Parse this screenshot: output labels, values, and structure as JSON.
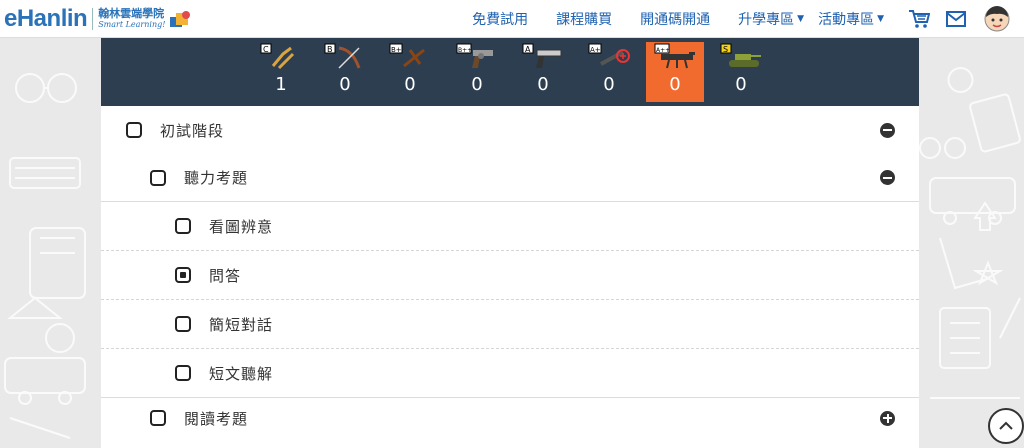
{
  "header": {
    "logo_text": "eHanlin",
    "logo_cn": "翰林雲端學院",
    "logo_en": "Smart Learning!",
    "nav": [
      {
        "label": "免費試用"
      },
      {
        "label": "課程購買"
      },
      {
        "label": "開通碼開通"
      },
      {
        "label": "升學專區",
        "caret": "▼"
      },
      {
        "label": "活動專區",
        "caret": "▼"
      }
    ],
    "icons": [
      "cart-icon",
      "mail-icon",
      "avatar"
    ]
  },
  "weapons": [
    {
      "grade": "C",
      "count": "1",
      "icon": "slingshot-icon"
    },
    {
      "grade": "B",
      "count": "0",
      "icon": "bow-icon"
    },
    {
      "grade": "B+",
      "count": "0",
      "icon": "crossbow-icon"
    },
    {
      "grade": "B++",
      "count": "0",
      "icon": "revolver-icon"
    },
    {
      "grade": "A",
      "count": "0",
      "icon": "pistol-icon"
    },
    {
      "grade": "A+",
      "count": "0",
      "icon": "rifle-icon"
    },
    {
      "grade": "A++",
      "count": "0",
      "icon": "machine-gun-icon",
      "active": true
    },
    {
      "grade": "S",
      "count": "0",
      "icon": "tank-icon"
    }
  ],
  "tree": [
    {
      "label": "初試階段",
      "level": 0,
      "checkbox": "empty",
      "toggle": "minus"
    },
    {
      "label": "聽力考題",
      "level": 1,
      "checkbox": "empty",
      "toggle": "minus"
    },
    {
      "label": "看圖辨意",
      "level": 2,
      "checkbox": "empty"
    },
    {
      "label": "問答",
      "level": 2,
      "checkbox": "partial"
    },
    {
      "label": "簡短對話",
      "level": 2,
      "checkbox": "empty"
    },
    {
      "label": "短文聽解",
      "level": 2,
      "checkbox": "empty"
    },
    {
      "label": "閱讀考題",
      "level": 1,
      "checkbox": "empty",
      "toggle": "plus"
    }
  ],
  "colors": {
    "brand_blue": "#2a73b8",
    "nav_blue": "#1f62b0",
    "weapons_bg": "#2c3e50",
    "active_orange": "#f26b2e"
  }
}
